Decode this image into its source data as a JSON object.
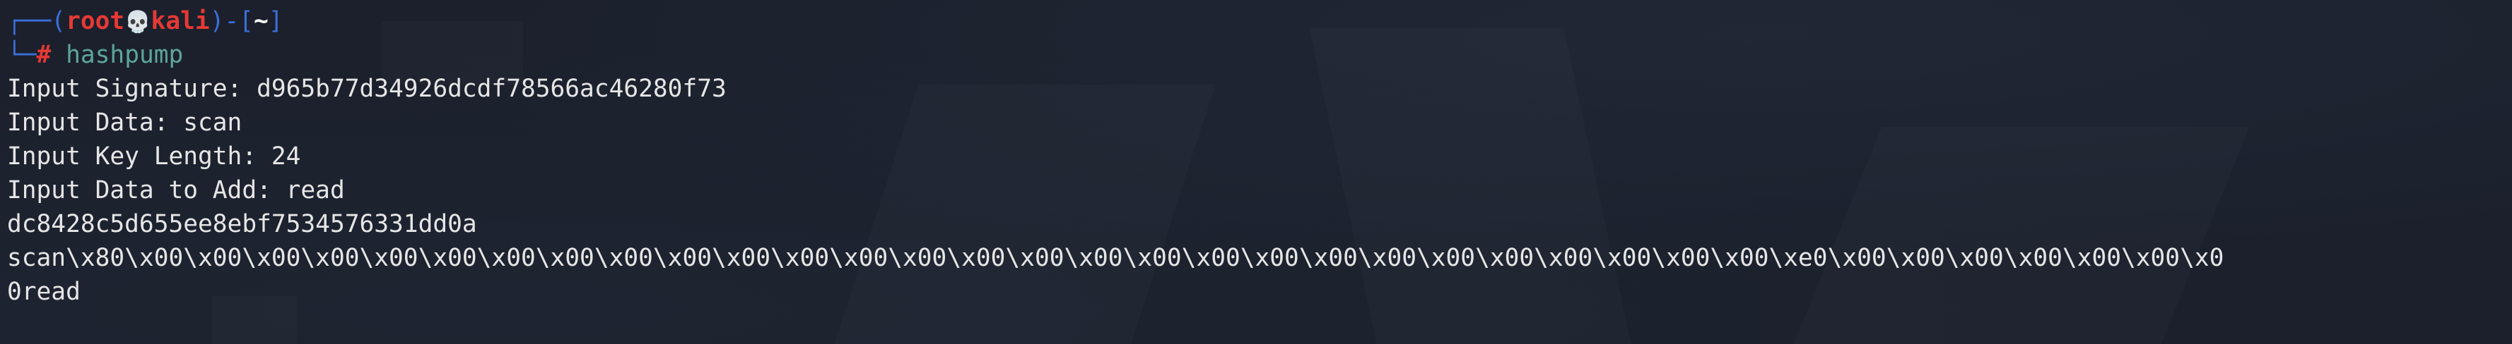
{
  "prompt": {
    "box_top": "┌──(",
    "user": "root",
    "skull": "💀",
    "host": "kali",
    "mid": ")-[",
    "dir": "~",
    "end": "]",
    "box_bottom": "└─",
    "symbol": "#",
    "command": "hashpump"
  },
  "output": [
    "Input Signature: d965b77d34926dcdf78566ac46280f73",
    "Input Data: scan",
    "Input Key Length: 24",
    "Input Data to Add: read",
    "dc8428c5d655ee8ebf7534576331dd0a",
    "scan\\x80\\x00\\x00\\x00\\x00\\x00\\x00\\x00\\x00\\x00\\x00\\x00\\x00\\x00\\x00\\x00\\x00\\x00\\x00\\x00\\x00\\x00\\x00\\x00\\x00\\x00\\x00\\x00\\x00\\xe0\\x00\\x00\\x00\\x00\\x00\\x00\\x0",
    "0read"
  ],
  "colors": {
    "background": "#1b202c",
    "prompt_frame": "#3a6fd8",
    "prompt_user": "#e53935",
    "command": "#5ea59a",
    "text": "#e6e6e6"
  }
}
